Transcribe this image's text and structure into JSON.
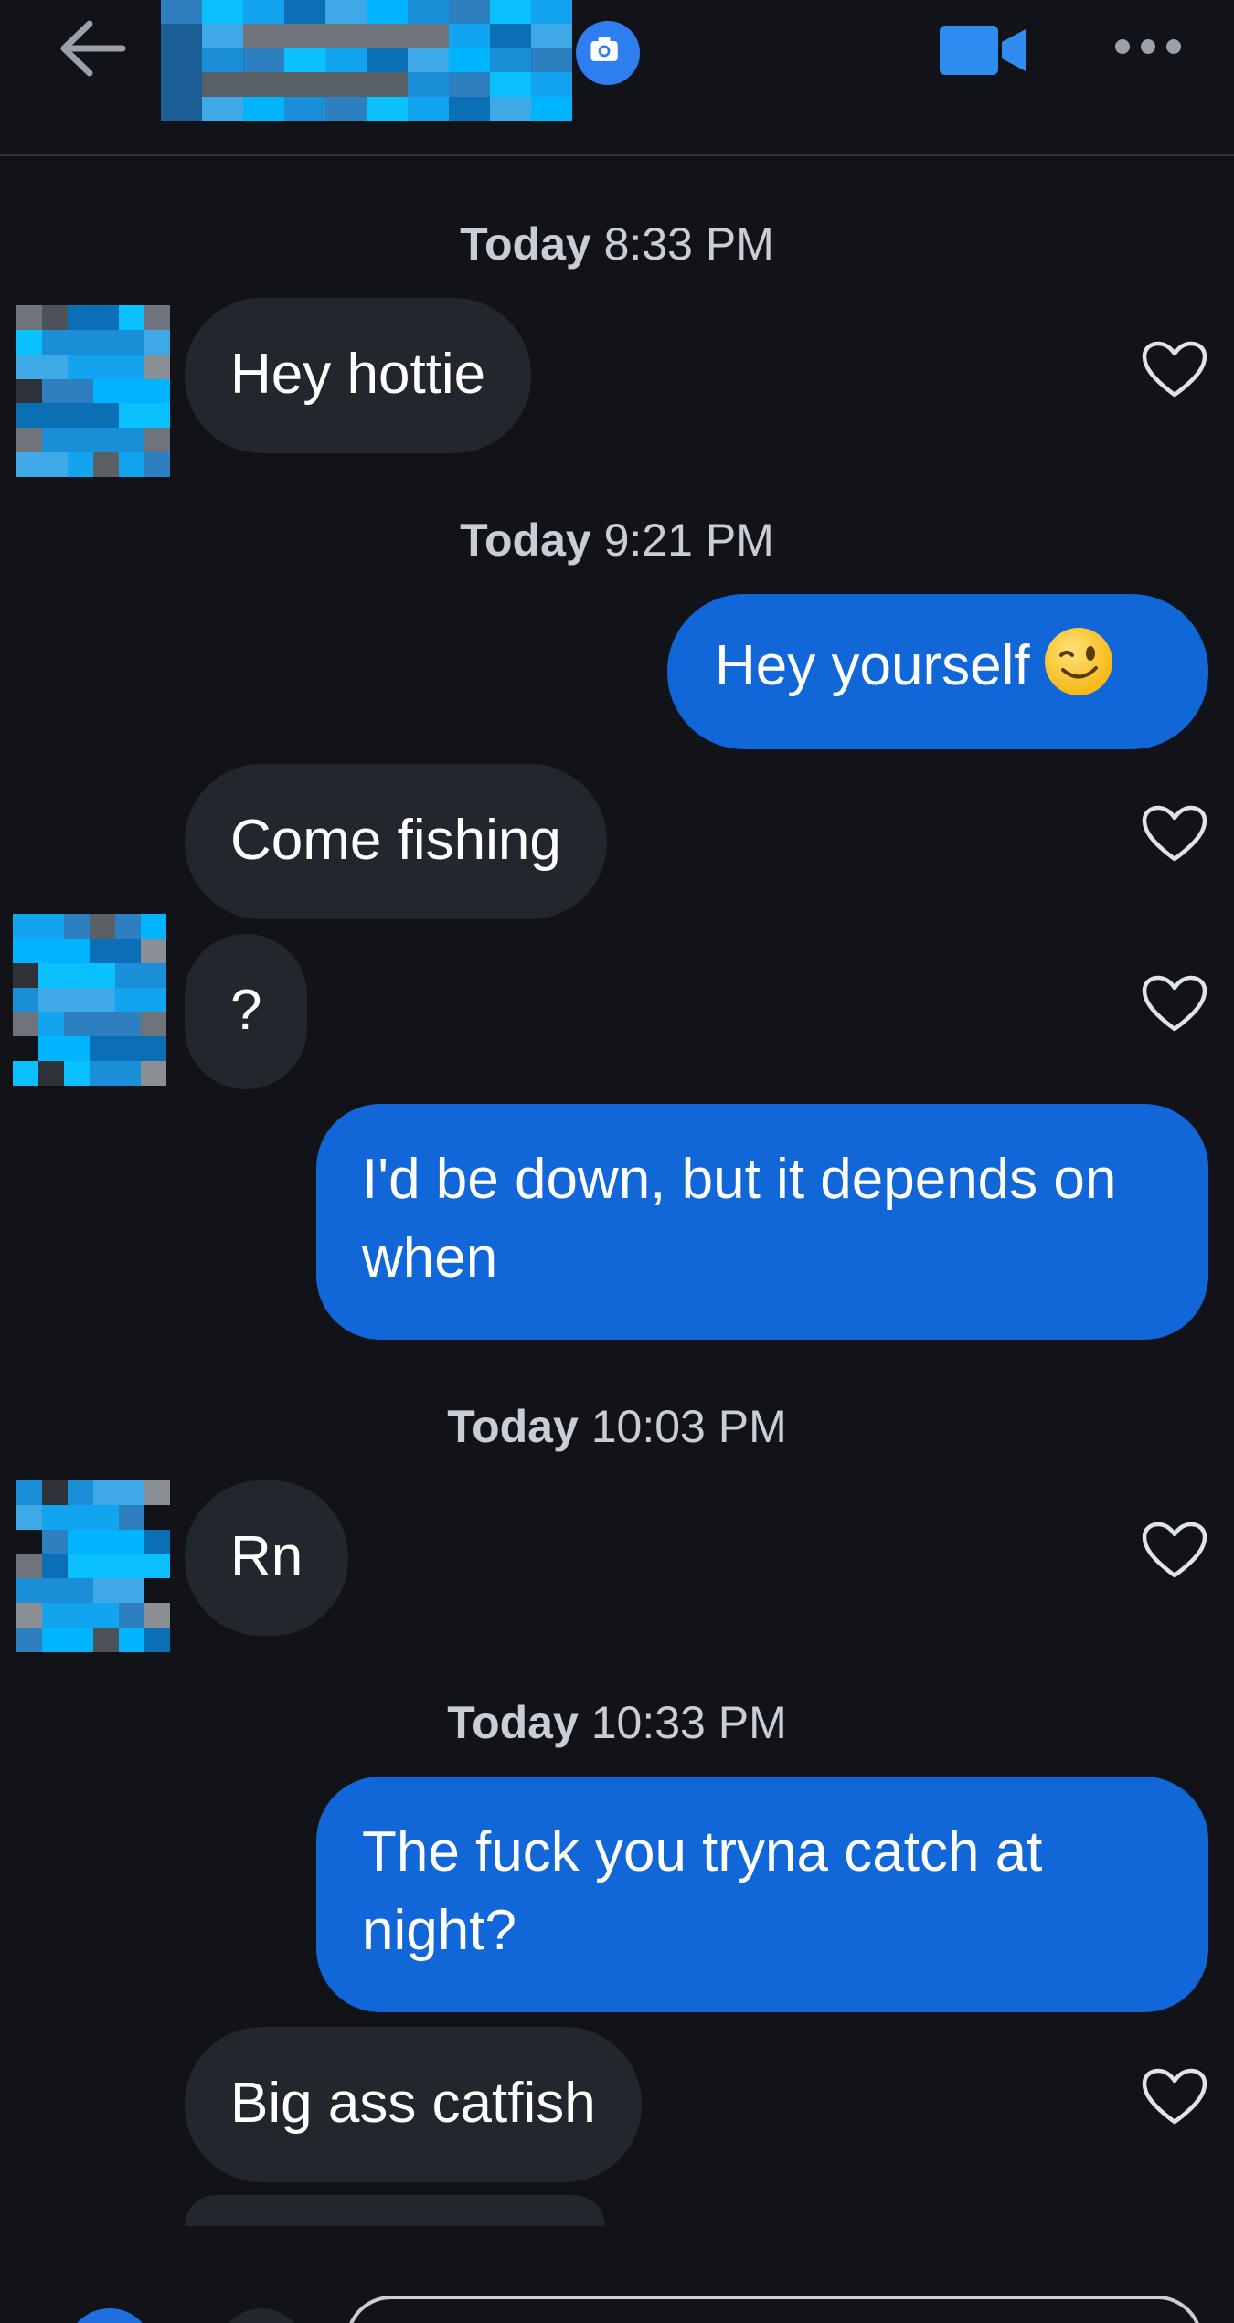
{
  "header": {
    "contact_name": "",
    "back_icon": "arrow-left-icon",
    "camera_icon": "camera-icon",
    "video_icon": "video-camera-icon",
    "more_icon": "more-horizontal-icon",
    "accent_color": "#2f7ef0"
  },
  "messages": [
    {
      "type": "timestamp",
      "day": "Today",
      "time": "8:33 PM"
    },
    {
      "type": "incoming",
      "text": "Hey hottie",
      "liked": false
    },
    {
      "type": "timestamp",
      "day": "Today",
      "time": "9:21 PM"
    },
    {
      "type": "outgoing",
      "text": "Hey yourself",
      "emoji": "winking-face-emoji"
    },
    {
      "type": "incoming",
      "text": "Come fishing",
      "liked": false
    },
    {
      "type": "incoming",
      "text": "?",
      "liked": false
    },
    {
      "type": "outgoing",
      "text": "I'd be down, but it depends on when"
    },
    {
      "type": "timestamp",
      "day": "Today",
      "time": "10:03 PM"
    },
    {
      "type": "incoming",
      "text": "Rn",
      "liked": false
    },
    {
      "type": "timestamp",
      "day": "Today",
      "time": "10:33 PM"
    },
    {
      "type": "outgoing",
      "text": "The fuck you tryna catch at night?"
    },
    {
      "type": "incoming",
      "text": "Big ass catfish",
      "liked": false
    }
  ],
  "colors": {
    "background": "#111318",
    "incoming_bubble": "#22262d",
    "outgoing_bubble": "#1166d8",
    "timestamp_text": "#c9cdd6"
  },
  "composer": {
    "placeholder": ""
  }
}
